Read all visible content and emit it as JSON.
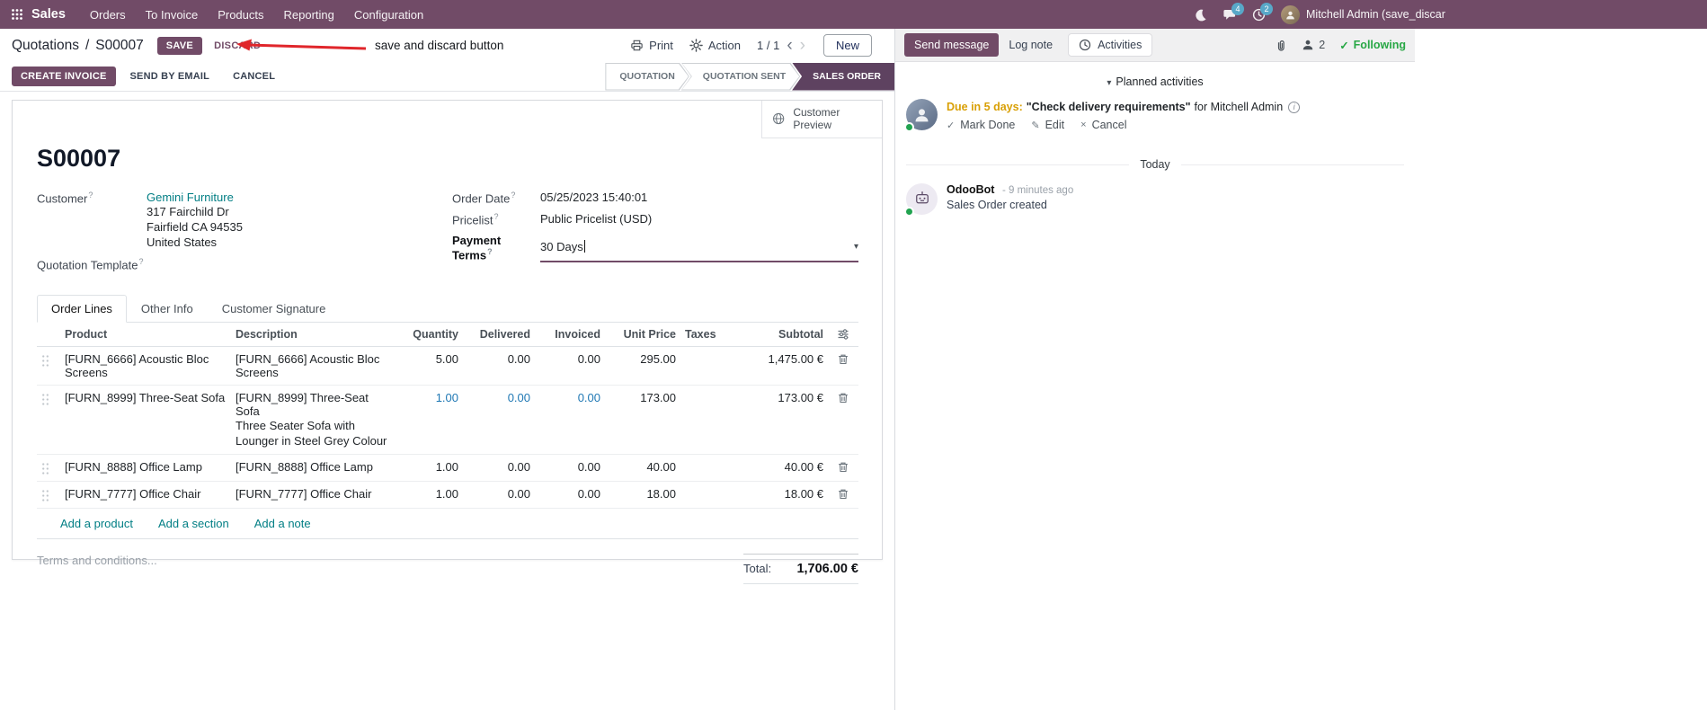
{
  "colors": {
    "brand": "#714B67",
    "link_teal": "#017e84",
    "edited_value_blue": "#1f78b4",
    "status_active": "#5e4260",
    "following_green": "#28a745",
    "due_amber": "#d9a006",
    "annotation_red": "#e0262b"
  },
  "icons": {
    "help": "?",
    "caret_down": "▾",
    "chevron_left": "‹",
    "chevron_right": "›",
    "check": "✓",
    "pencil": "✎",
    "cross": "×",
    "info": "i"
  },
  "nav": {
    "app_name": "Sales",
    "menus": [
      "Orders",
      "To Invoice",
      "Products",
      "Reporting",
      "Configuration"
    ],
    "messages_badge": "4",
    "activities_badge": "2",
    "user_name": "Mitchell Admin (save_discar"
  },
  "breadcrumb": {
    "parent": "Quotations",
    "separator": "/",
    "current": "S00007",
    "save_label": "SAVE",
    "discard_label": "DISCARD"
  },
  "annotation": {
    "text": "save and discard button"
  },
  "control_panel": {
    "print_label": "Print",
    "action_label": "Action",
    "pager": "1 / 1",
    "new_label": "New"
  },
  "statusbar": {
    "create_invoice": "CREATE INVOICE",
    "send_by_email": "SEND BY EMAIL",
    "cancel": "CANCEL",
    "states": [
      {
        "label": "QUOTATION"
      },
      {
        "label": "QUOTATION SENT"
      },
      {
        "label": "SALES ORDER"
      }
    ]
  },
  "form": {
    "customer_preview": "Customer Preview",
    "title": "S00007",
    "customer": {
      "label": "Customer",
      "name": "Gemini Furniture",
      "address_line1": "317 Fairchild Dr",
      "address_line2": "Fairfield CA 94535",
      "address_line3": "United States"
    },
    "quotation_template_label": "Quotation Template",
    "order_date": {
      "label": "Order Date",
      "value": "05/25/2023 15:40:01"
    },
    "pricelist": {
      "label": "Pricelist",
      "value": "Public Pricelist (USD)"
    },
    "payment_terms": {
      "label": "Payment Terms",
      "value": "30 Days"
    },
    "tabs": [
      "Order Lines",
      "Other Info",
      "Customer Signature"
    ],
    "order_lines": {
      "columns": [
        "Product",
        "Description",
        "Quantity",
        "Delivered",
        "Invoiced",
        "Unit Price",
        "Taxes",
        "Subtotal"
      ],
      "rows": [
        {
          "product": "[FURN_6666] Acoustic Bloc Screens",
          "description": "[FURN_6666] Acoustic Bloc Screens",
          "description2": "",
          "quantity": "5.00",
          "delivered": "0.00",
          "invoiced": "0.00",
          "unit_price": "295.00",
          "taxes": "",
          "subtotal": "1,475.00 €"
        },
        {
          "product": "[FURN_8999] Three-Seat Sofa",
          "description": "[FURN_8999] Three-Seat Sofa",
          "description2": "Three Seater Sofa with Lounger in Steel Grey Colour",
          "quantity": "1.00",
          "delivered": "0.00",
          "invoiced": "0.00",
          "unit_price": "173.00",
          "taxes": "",
          "subtotal": "173.00 €"
        },
        {
          "product": "[FURN_8888] Office Lamp",
          "description": "[FURN_8888] Office Lamp",
          "description2": "",
          "quantity": "1.00",
          "delivered": "0.00",
          "invoiced": "0.00",
          "unit_price": "40.00",
          "taxes": "",
          "subtotal": "40.00 €"
        },
        {
          "product": "[FURN_7777] Office Chair",
          "description": "[FURN_7777] Office Chair",
          "description2": "",
          "quantity": "1.00",
          "delivered": "0.00",
          "invoiced": "0.00",
          "unit_price": "18.00",
          "taxes": "",
          "subtotal": "18.00 €"
        }
      ],
      "add_product": "Add a product",
      "add_section": "Add a section",
      "add_note": "Add a note"
    },
    "terms_placeholder": "Terms and conditions...",
    "total_label": "Total:",
    "total_value": "1,706.00 €"
  },
  "chatter": {
    "send_message": "Send message",
    "log_note": "Log note",
    "activities_tab": "Activities",
    "followers_count": "2",
    "following": "Following",
    "planned_activities": "Planned activities",
    "activity": {
      "due": "Due in 5 days:",
      "summary": "\"Check delivery requirements\"",
      "assignee": "for Mitchell Admin",
      "mark_done": "Mark Done",
      "edit": "Edit",
      "cancel": "Cancel"
    },
    "today": "Today",
    "message": {
      "author": "OdooBot",
      "timestamp": "- 9 minutes ago",
      "body": "Sales Order created"
    }
  }
}
